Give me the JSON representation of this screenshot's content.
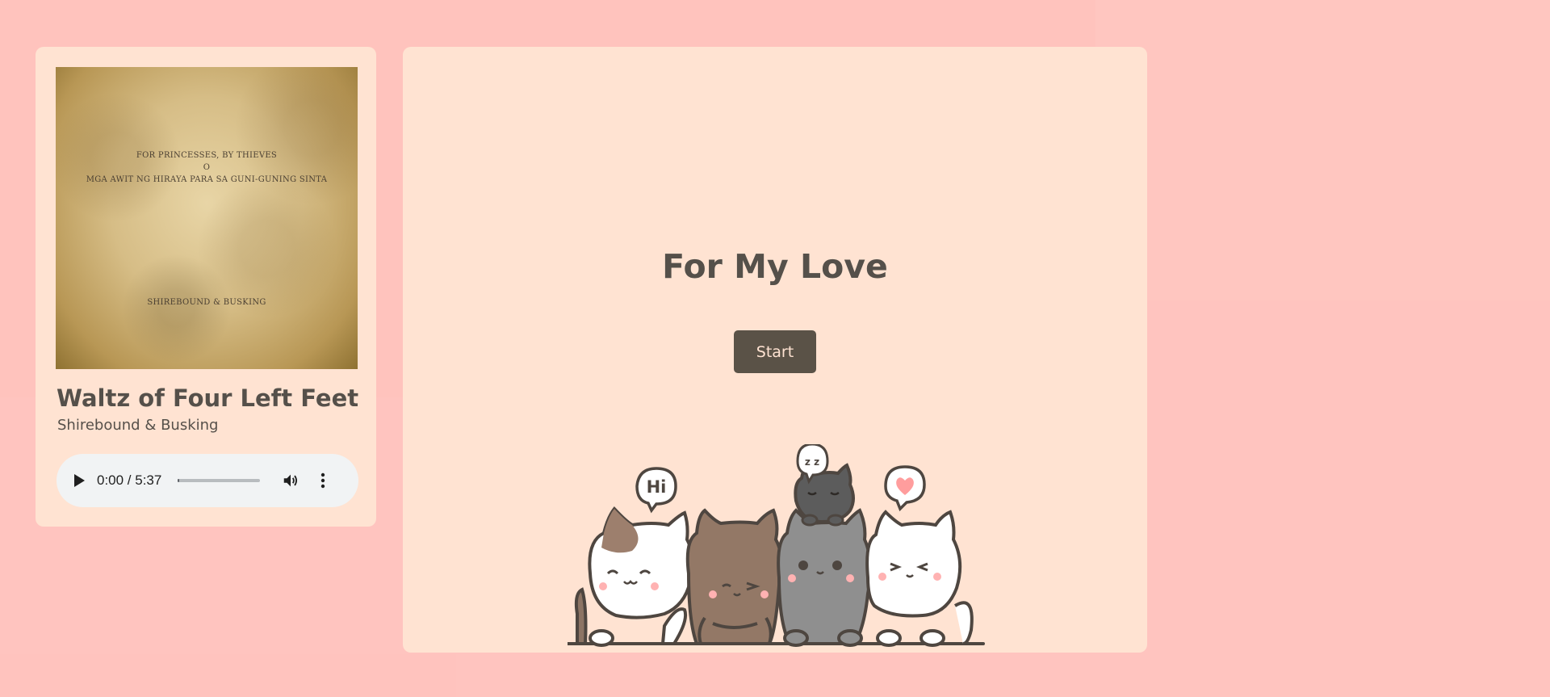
{
  "album": {
    "line1": "FOR PRINCESSES, BY THIEVES",
    "line2": "O",
    "line3": "MGA AWIT NG HIRAYA PARA SA GUNI-GUNING SINTA",
    "label": "SHIREBOUND & BUSKING"
  },
  "track": {
    "title": "Waltz of Four Left Feet",
    "artist": "Shirebound & Busking"
  },
  "audio": {
    "time": "0:00 / 5:37",
    "progress": 0.0
  },
  "main": {
    "title": "For My Love",
    "start_label": "Start"
  },
  "illustration": {
    "bubble_hi": "Hi",
    "bubble_zz": "z z"
  },
  "colors": {
    "background": "#ffc4bf",
    "card": "#ffe3d2",
    "text": "#55504a",
    "button": "#5a5247"
  }
}
